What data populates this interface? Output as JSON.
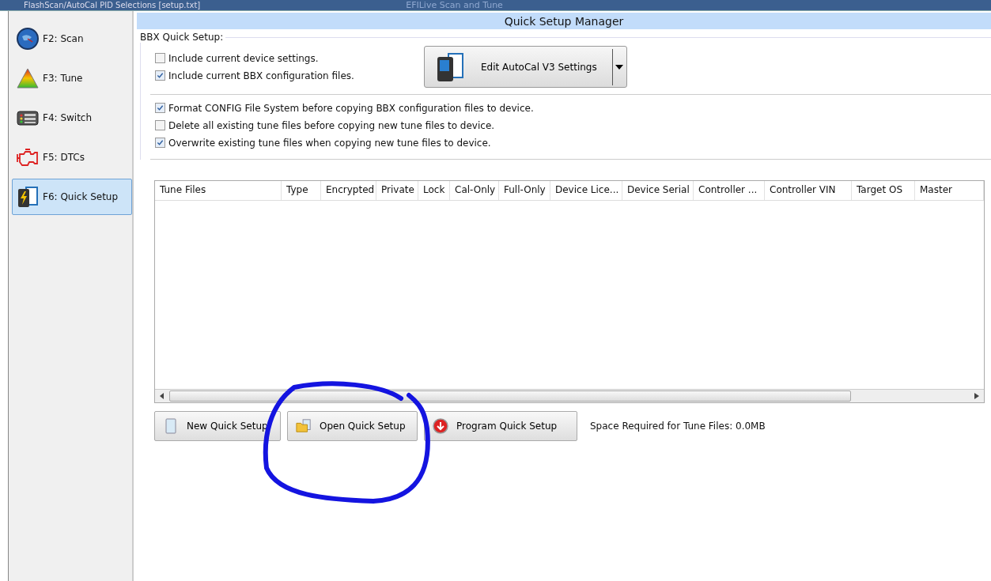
{
  "window": {
    "title": "FlashScan/AutoCal PID Selections [setup.txt]",
    "background_title": "EFILive Scan and Tune"
  },
  "sidebar": {
    "items": [
      {
        "label": "F2: Scan",
        "kind": "globe",
        "selected": false
      },
      {
        "label": "F3: Tune",
        "kind": "triangle",
        "selected": false
      },
      {
        "label": "F4: Switch",
        "kind": "panel",
        "selected": false
      },
      {
        "label": "F5: DTCs",
        "kind": "engine",
        "selected": false
      },
      {
        "label": "F6: Quick Setup",
        "kind": "device",
        "selected": true
      }
    ]
  },
  "header": {
    "title": "Quick Setup Manager"
  },
  "group": {
    "title": "BBX Quick Setup:"
  },
  "include_options": [
    {
      "label": "Include current device settings.",
      "checked": false
    },
    {
      "label": "Include current BBX configuration files.",
      "checked": true
    }
  ],
  "edit_button": {
    "label": "Edit AutoCal V3 Settings"
  },
  "copy_options": [
    {
      "label": "Format CONFIG File System before copying BBX configuration files to device.",
      "checked": true
    },
    {
      "label": "Delete all existing tune files before copying new tune files to device.",
      "checked": false
    },
    {
      "label": "Overwrite existing tune files when copying new tune files to device.",
      "checked": true
    }
  ],
  "table": {
    "columns": [
      "Tune Files",
      "Type",
      "Encrypted",
      "Private",
      "Lock",
      "Cal-Only",
      "Full-Only",
      "Device Lice...",
      "Device Serial",
      "Controller ...",
      "Controller VIN",
      "Target OS",
      "Master"
    ]
  },
  "buttons": [
    {
      "label": "New Quick Setup",
      "kind": "new"
    },
    {
      "label": "Open Quick Setup",
      "kind": "open"
    },
    {
      "label": "Program Quick Setup",
      "kind": "program"
    }
  ],
  "status": "Space Required for Tune Files: 0.0MB"
}
